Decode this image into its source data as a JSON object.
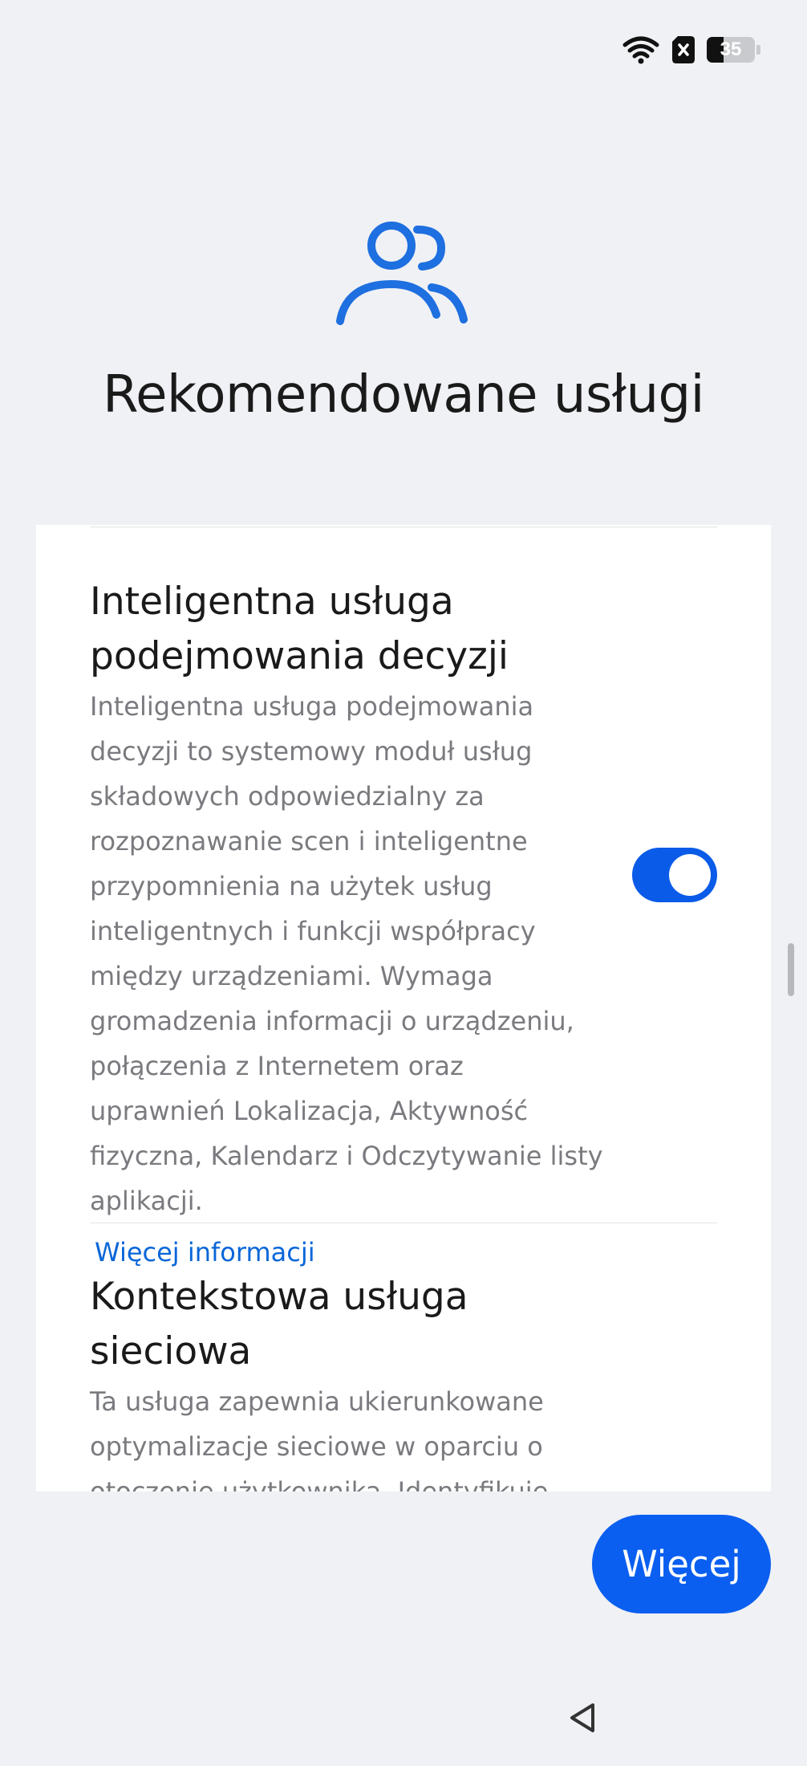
{
  "status_bar": {
    "battery_level": "35",
    "icons": [
      "wifi-icon",
      "sim-error-icon",
      "battery-icon"
    ]
  },
  "header": {
    "icon": "people-icon",
    "title": "Rekomendowane usługi"
  },
  "services": [
    {
      "title": "Inteligentna usługa podejmowania decyzji",
      "description": "Inteligentna usługa podejmowania decyzji to systemowy moduł usług składowych odpowiedzialny za rozpoznawanie scen i inteligentne przypomnienia na użytek usług inteligentnych i funkcji współpracy między urządzeniami. Wymaga gromadzenia informacji o urządzeniu, połączenia z Internetem oraz uprawnień Lokalizacja, Aktywność fizyczna, Kalendarz i Odczytywanie listy aplikacji.",
      "link": "Więcej informacji",
      "toggle_on": true
    },
    {
      "title": "Kontekstowa usługa sieciowa",
      "description": "Ta usługa zapewnia ukierunkowane optymalizacje sieciowe w oparciu o otoczenie użytkownika. Identyfikuje"
    }
  ],
  "colors": {
    "accent": "#0a5ff0",
    "link": "#0a66d8",
    "background": "#f0f1f5"
  },
  "footer": {
    "more_button": "Więcej"
  },
  "nav": {
    "back_icon": "back-triangle-icon"
  }
}
